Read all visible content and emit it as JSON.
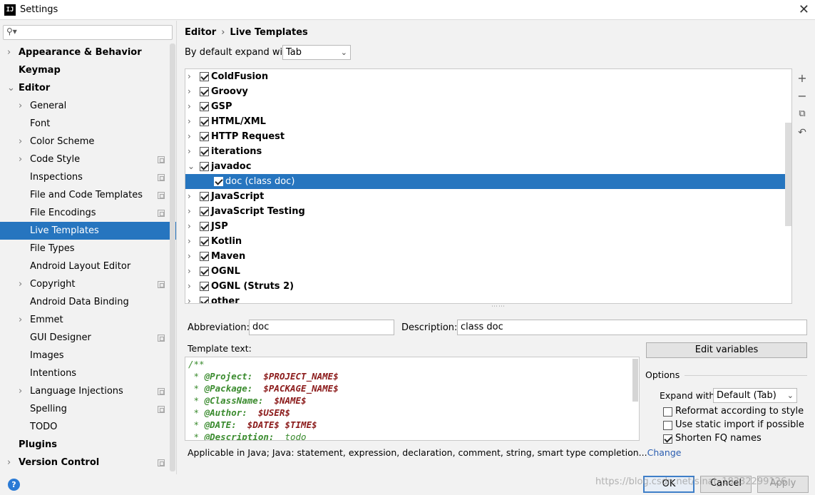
{
  "window": {
    "title": "Settings",
    "logo": "IJ"
  },
  "sidebar": {
    "search_icon": "magnifier-icon",
    "items": [
      {
        "label": "Appearance & Behavior",
        "bold": true,
        "chevron": "›"
      },
      {
        "label": "Keymap",
        "bold": true
      },
      {
        "label": "Editor",
        "bold": true,
        "chevron": "⌄"
      },
      {
        "label": "General",
        "chevron": "›"
      },
      {
        "label": "Font"
      },
      {
        "label": "Color Scheme",
        "chevron": "›"
      },
      {
        "label": "Code Style",
        "chevron": "›",
        "project": true
      },
      {
        "label": "Inspections",
        "project": true
      },
      {
        "label": "File and Code Templates",
        "project": true
      },
      {
        "label": "File Encodings",
        "project": true
      },
      {
        "label": "Live Templates",
        "selected": true
      },
      {
        "label": "File Types"
      },
      {
        "label": "Android Layout Editor"
      },
      {
        "label": "Copyright",
        "chevron": "›",
        "project": true
      },
      {
        "label": "Android Data Binding"
      },
      {
        "label": "Emmet",
        "chevron": "›"
      },
      {
        "label": "GUI Designer",
        "project": true
      },
      {
        "label": "Images"
      },
      {
        "label": "Intentions"
      },
      {
        "label": "Language Injections",
        "chevron": "›",
        "project": true
      },
      {
        "label": "Spelling",
        "project": true
      },
      {
        "label": "TODO"
      },
      {
        "label": "Plugins",
        "bold": true
      },
      {
        "label": "Version Control",
        "bold": true,
        "chevron": "›",
        "project": true
      }
    ]
  },
  "breadcrumb": {
    "first": "Editor",
    "sep": "›",
    "second": "Live Templates"
  },
  "expand_default": {
    "label": "By default expand with",
    "value": "Tab"
  },
  "template_groups": [
    {
      "name": "ColdFusion",
      "checked": true
    },
    {
      "name": "Groovy",
      "checked": true
    },
    {
      "name": "GSP",
      "checked": true
    },
    {
      "name": "HTML/XML",
      "checked": true
    },
    {
      "name": "HTTP Request",
      "checked": true
    },
    {
      "name": "iterations",
      "checked": true
    },
    {
      "name": "javadoc",
      "checked": true,
      "expanded": true
    },
    {
      "name": "doc (class doc)",
      "checked": true,
      "child": true,
      "selected": true
    },
    {
      "name": "JavaScript",
      "checked": true
    },
    {
      "name": "JavaScript Testing",
      "checked": true
    },
    {
      "name": "JSP",
      "checked": true
    },
    {
      "name": "Kotlin",
      "checked": true
    },
    {
      "name": "Maven",
      "checked": true
    },
    {
      "name": "OGNL",
      "checked": true
    },
    {
      "name": "OGNL (Struts 2)",
      "checked": true
    },
    {
      "name": "other",
      "checked": true
    }
  ],
  "toolbar": {
    "add": "+",
    "remove": "−",
    "copy_icon": "copy-icon",
    "restore_icon": "undo-icon"
  },
  "abbreviation": {
    "label": "Abbreviation:",
    "value": "doc"
  },
  "description": {
    "label": "Description:",
    "value": "class doc"
  },
  "template_text": {
    "label": "Template text:",
    "lines": [
      [
        {
          "t": "/**",
          "c": "c-green"
        }
      ],
      [
        {
          "t": " * ",
          "c": "c-green"
        },
        {
          "t": "@Project:",
          "c": "c-tag"
        },
        {
          "t": "  ",
          "c": "c-green"
        },
        {
          "t": "$PROJECT_NAME$",
          "c": "c-var"
        }
      ],
      [
        {
          "t": " * ",
          "c": "c-green"
        },
        {
          "t": "@Package:",
          "c": "c-tag"
        },
        {
          "t": "  ",
          "c": "c-green"
        },
        {
          "t": "$PACKAGE_NAME$",
          "c": "c-var"
        }
      ],
      [
        {
          "t": " * ",
          "c": "c-green"
        },
        {
          "t": "@ClassName:",
          "c": "c-tag"
        },
        {
          "t": "  ",
          "c": "c-green"
        },
        {
          "t": "$NAME$",
          "c": "c-var"
        }
      ],
      [
        {
          "t": " * ",
          "c": "c-green"
        },
        {
          "t": "@Author:",
          "c": "c-tag"
        },
        {
          "t": "  ",
          "c": "c-green"
        },
        {
          "t": "$USER$",
          "c": "c-var"
        }
      ],
      [
        {
          "t": " * ",
          "c": "c-green"
        },
        {
          "t": "@DATE:",
          "c": "c-tag"
        },
        {
          "t": "  ",
          "c": "c-green"
        },
        {
          "t": "$DATE$ $TIME$",
          "c": "c-var"
        }
      ],
      [
        {
          "t": " * ",
          "c": "c-green"
        },
        {
          "t": "@Description:",
          "c": "c-tag"
        },
        {
          "t": "  todo",
          "c": "c-green"
        }
      ]
    ]
  },
  "applicable": {
    "text": "Applicable in Java; Java: statement, expression, declaration, comment, string, smart type completion...",
    "change": "Change"
  },
  "edit_variables": "Edit variables",
  "options": {
    "title": "Options",
    "expand_label": "Expand with",
    "expand_value": "Default (Tab)",
    "checks": [
      {
        "label": "Reformat according to style",
        "checked": false
      },
      {
        "label": "Use static import if possible",
        "checked": false
      },
      {
        "label": "Shorten FQ names",
        "checked": true
      }
    ]
  },
  "footer": {
    "help": "?",
    "ok": "OK",
    "cancel": "Cancel",
    "apply": "Apply",
    "watermark": "https://blog.csdn.net/sinat_18332299126"
  }
}
